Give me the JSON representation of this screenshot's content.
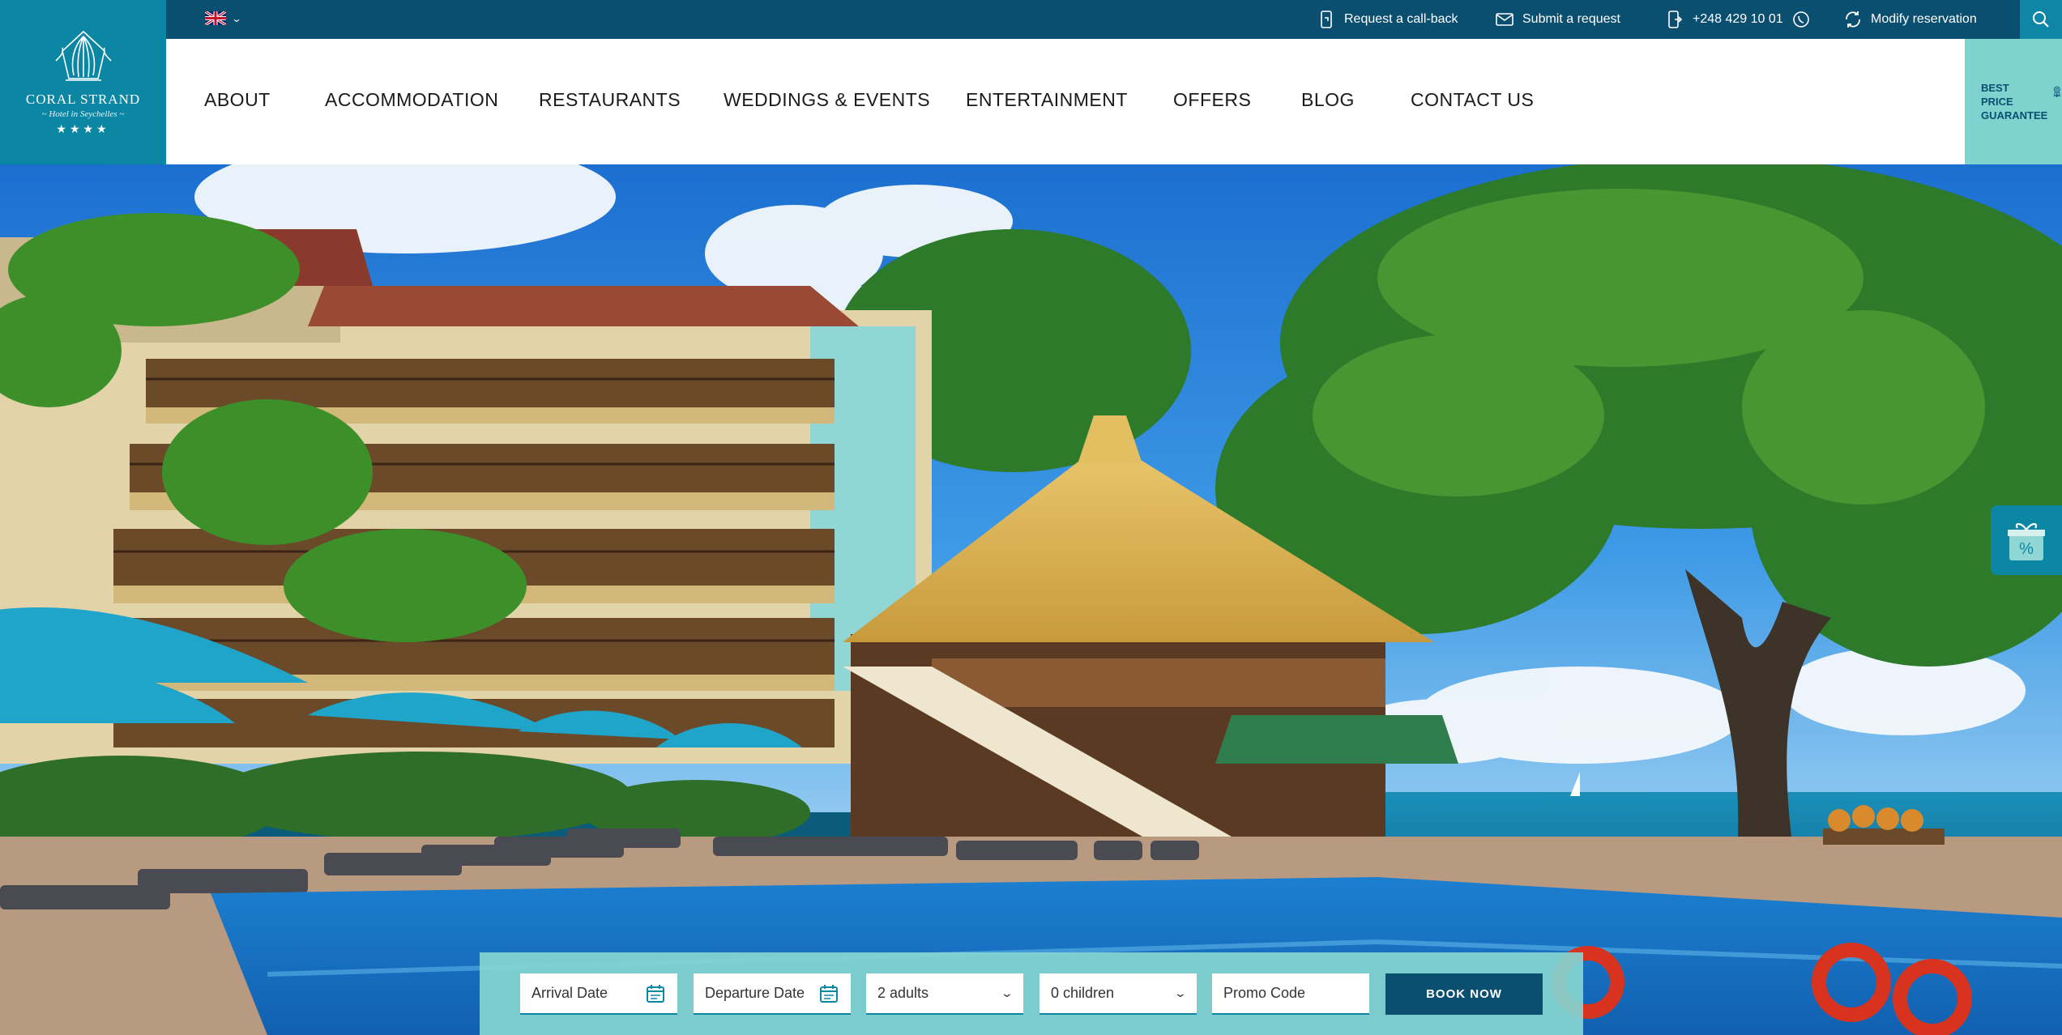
{
  "brand": {
    "name": "CORAL STRAND",
    "subtitle": "~ Hotel in Seychelles ~",
    "stars": "★★★★"
  },
  "topbar": {
    "language_icon": "uk-flag-icon",
    "callback": "Request a call-back",
    "submit": "Submit a request",
    "phone": "+248 429 10 01",
    "modify": "Modify reservation"
  },
  "nav": {
    "items": [
      "ABOUT",
      "ACCOMMODATION",
      "RESTAURANTS",
      "WEDDINGS & EVENTS",
      "ENTERTAINMENT",
      "OFFERS",
      "BLOG",
      "CONTACT US"
    ]
  },
  "guarantee": {
    "line1": "BEST",
    "line2": "PRICE",
    "line3": "GUARANTEE"
  },
  "booking": {
    "arrival": "Arrival Date",
    "departure": "Departure Date",
    "adults": "2 adults",
    "children": "0 children",
    "promo_placeholder": "Promo Code",
    "book_label": "BOOK NOW"
  },
  "colors": {
    "topbar": "#0b4f70",
    "logo_bg": "#0b86a3",
    "guarantee_bg": "#7fd3cf",
    "book_button": "#0b4f70"
  }
}
